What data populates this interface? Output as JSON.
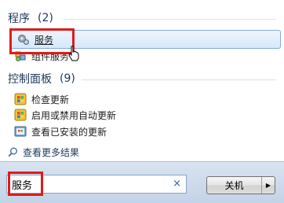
{
  "groups": [
    {
      "title": "程序",
      "count": "(2)",
      "items": [
        {
          "label": "服务",
          "icon": "gears-icon"
        },
        {
          "label": "组件服务",
          "icon": "component-services-icon"
        }
      ]
    },
    {
      "title": "控制面板",
      "count": "(9)",
      "items": [
        {
          "label": "检查更新",
          "icon": "windows-update-icon"
        },
        {
          "label": "启用或禁用自动更新",
          "icon": "windows-update-icon"
        },
        {
          "label": "查看已安装的更新",
          "icon": "installed-updates-icon"
        }
      ]
    }
  ],
  "more_results": "查看更多结果",
  "search": {
    "value": "服务",
    "clear": "×"
  },
  "shutdown": {
    "label": "关机",
    "arrow": "▶"
  },
  "colors": {
    "highlight": "#e01b1b",
    "selected_bg": "#d6e8fa",
    "header": "#1e395b"
  }
}
